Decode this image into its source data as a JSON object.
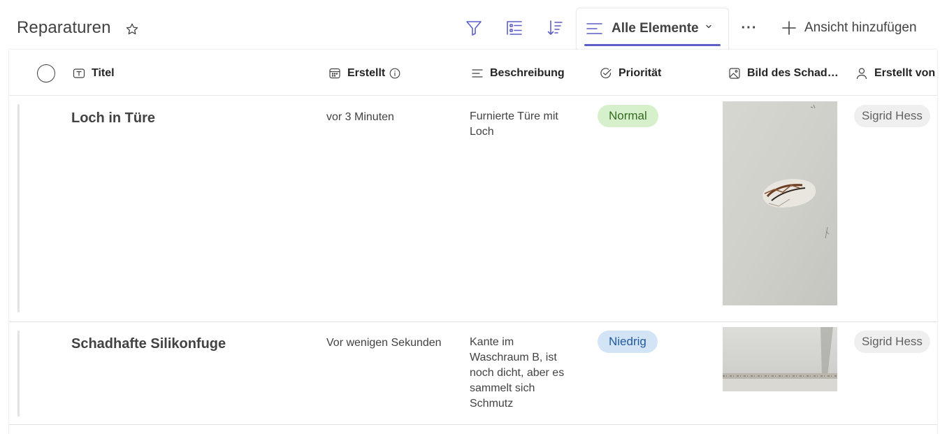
{
  "header": {
    "title": "Reparaturen",
    "favorite_icon": "star-icon",
    "toolbar_icons": [
      "filter-icon",
      "group-by-icon",
      "sort-icon"
    ],
    "view": {
      "label": "Alle Elemente",
      "icon": "list-view-icon",
      "dropdown_icon": "chevron-down-icon"
    },
    "more_label": "···",
    "add_view_label": "Ansicht hinzufügen"
  },
  "columns": [
    {
      "label": "Titel",
      "icon": "text-field-icon"
    },
    {
      "label": "Erstellt",
      "icon": "calendar-icon",
      "info_icon": "info-icon"
    },
    {
      "label": "Beschreibung",
      "icon": "multiline-text-icon"
    },
    {
      "label": "Priorität",
      "icon": "choice-check-icon"
    },
    {
      "label": "Bild des Schad…",
      "icon": "image-icon"
    },
    {
      "label": "Erstellt von",
      "icon": "person-icon"
    }
  ],
  "rows": [
    {
      "title": "Loch in Türe",
      "created": "vor 3 Minuten",
      "description": "Furnierte Türe mit Loch",
      "priority": "Normal",
      "image": "door-hole-photo",
      "created_by": "Sigrid Hess"
    },
    {
      "title": "Schadhafte Silikonfuge",
      "created": "Vor wenigen Sekunden",
      "description": "Kante im Waschraum B, ist noch dicht, aber es sammelt sich Schmutz",
      "priority": "Niedrig",
      "image": "silicone-joint-photo",
      "created_by": "Sigrid Hess"
    }
  ],
  "colors": {
    "accent": "#5b5fc7",
    "priority_normal_bg": "#d6f0cb",
    "priority_low_bg": "#d4e4f7"
  }
}
